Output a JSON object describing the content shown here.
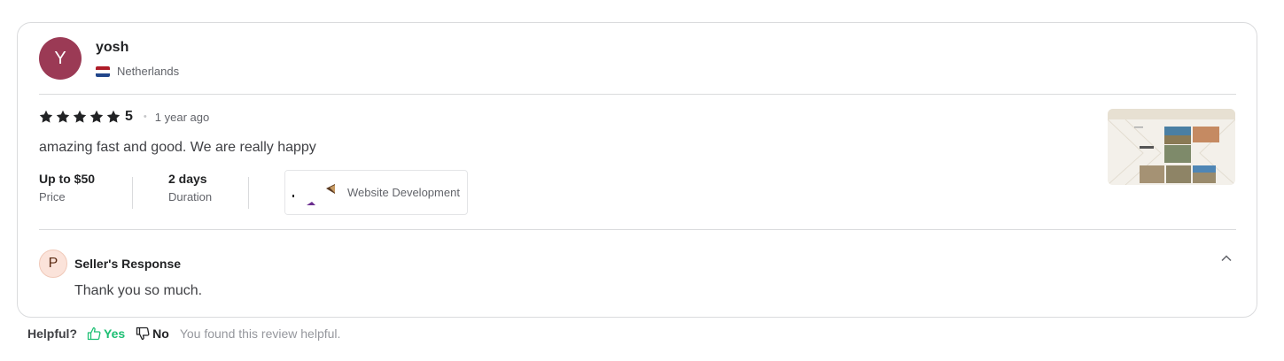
{
  "reviewer": {
    "avatar_letter": "Y",
    "avatar_color": "#9b3a55",
    "name": "yosh",
    "country": "Netherlands",
    "flag_icon": "netherlands-flag-icon"
  },
  "review": {
    "rating": "5",
    "rating_value": 5,
    "star_icon": "star-icon",
    "time_ago": "1 year ago",
    "text": "amazing fast and good. We are really happy",
    "price_value": "Up to $50",
    "price_label": "Price",
    "duration_value": "2 days",
    "duration_label": "Duration",
    "gig_category": "Website Development"
  },
  "seller_response": {
    "avatar_letter": "P",
    "title": "Seller's Response",
    "text": "Thank you so much.",
    "toggle_icon": "chevron-up-icon"
  },
  "helpful": {
    "question": "Helpful?",
    "yes_label": "Yes",
    "no_label": "No",
    "status": "You found this review helpful.",
    "accent_color": "#1dbf73"
  }
}
